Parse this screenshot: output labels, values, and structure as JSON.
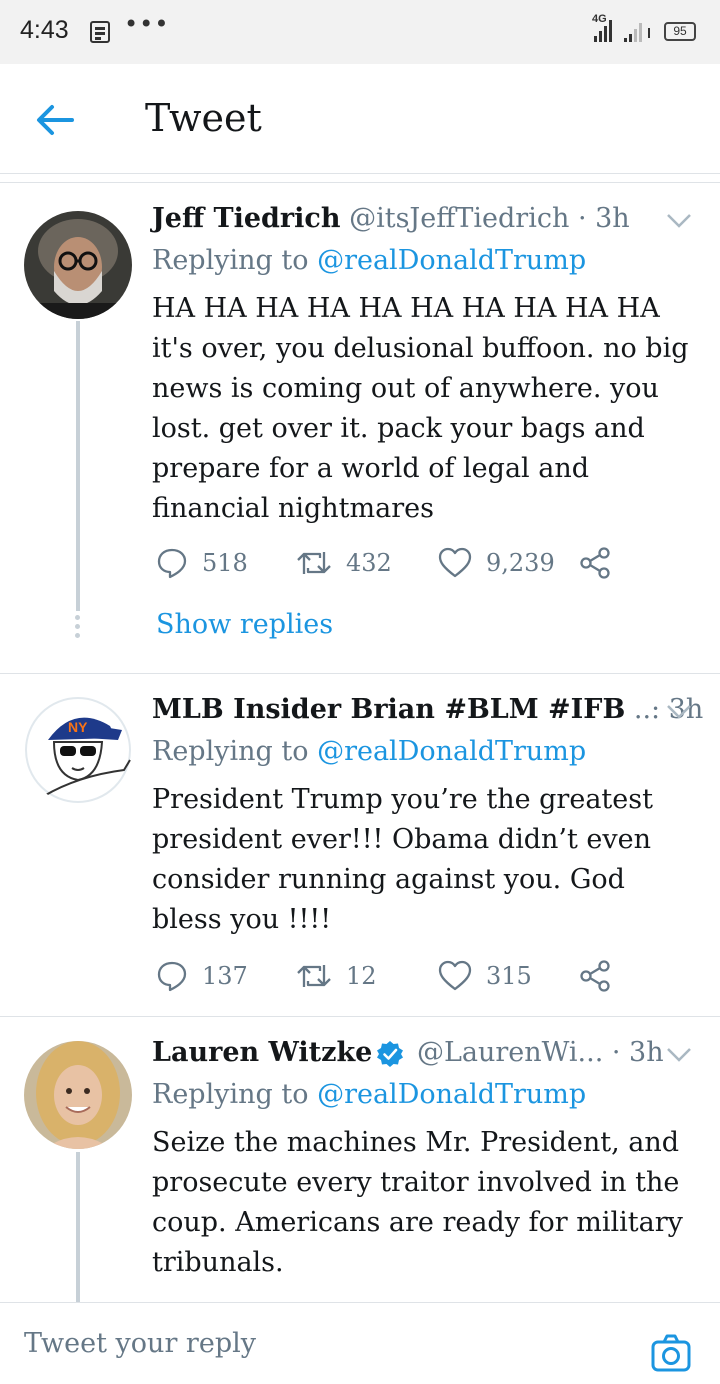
{
  "status_bar": {
    "time": "4:43",
    "network": "4G",
    "battery": "95"
  },
  "header": {
    "title": "Tweet",
    "back_icon": "arrow-left-icon",
    "accent_color": "#1b95e0"
  },
  "tweets": [
    {
      "display_name": "Jeff Tiedrich",
      "handle": "@itsJeffTiedrich",
      "time": "· 3h",
      "replying_prefix": "Replying to",
      "replying_to": "@realDonaldTrump",
      "text": "HA HA HA HA HA HA HA HA HA HA it's over, you delusional buffoon. no big news is coming out of anywhere. you lost. get over it. pack your bags and prepare for a world of legal and financial nightmares",
      "replies": "518",
      "retweets": "432",
      "likes": "9,239",
      "show_replies": "Show replies"
    },
    {
      "display_name": "MLB Insider Brian #BLM #IFB",
      "handle": "",
      "time": "..: 3h",
      "replying_prefix": "Replying to",
      "replying_to": "@realDonaldTrump",
      "text": "President Trump you’re the greatest president ever!!! Obama didn’t even consider running against you. God bless you !!!!",
      "replies": "137",
      "retweets": "12",
      "likes": "315"
    },
    {
      "display_name": "Lauren Witzke",
      "verified": true,
      "handle": "@LaurenWi...",
      "time": "· 3h",
      "replying_prefix": "Replying to",
      "replying_to": "@realDonaldTrump",
      "text": "Seize the machines Mr. President, and prosecute every traitor involved in the coup. Americans are ready for military tribunals."
    }
  ],
  "reply_bar": {
    "placeholder": "Tweet your reply",
    "camera_icon": "camera-icon"
  }
}
